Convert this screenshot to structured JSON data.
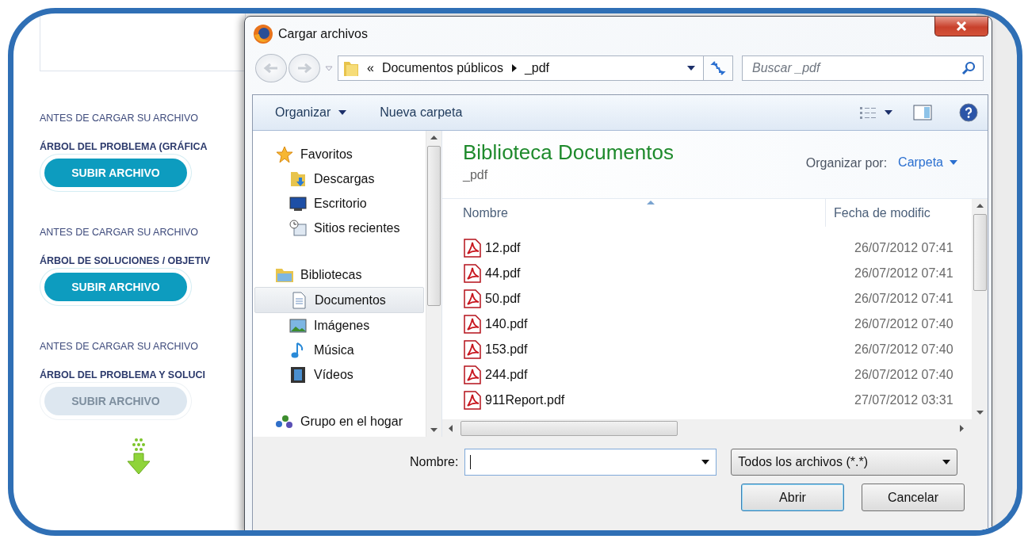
{
  "page": {
    "sections": [
      {
        "note": "ANTES DE CARGAR SU ARCHIVO",
        "title": "ÁRBOL DEL PROBLEMA (GRÁFICA",
        "button": {
          "label": "SUBIR ARCHIVO",
          "disabled": false
        }
      },
      {
        "note": "ANTES DE CARGAR SU ARCHIVO",
        "title": "ÁRBOL DE SOLUCIONES / OBJETIV",
        "button": {
          "label": "SUBIR ARCHIVO",
          "disabled": false
        }
      },
      {
        "note": "ANTES DE CARGAR SU ARCHIVO",
        "title": "ÁRBOL DEL PROBLEMA Y SOLUCI",
        "button": {
          "label": "SUBIR ARCHIVO",
          "disabled": true
        }
      }
    ]
  },
  "dialog": {
    "title": "Cargar archivos",
    "breadcrumb": {
      "prefix": "«",
      "path": [
        "Documentos públicos",
        "_pdf"
      ]
    },
    "search": {
      "placeholder": "Buscar _pdf"
    },
    "toolbar": [
      {
        "label": "Organizar",
        "kind": "menu"
      },
      {
        "label": "Nueva carpeta",
        "kind": "button"
      }
    ],
    "nav": [
      {
        "label": "Favoritos",
        "kind": "star",
        "selected": false,
        "children": [
          {
            "label": "Descargas",
            "kind": "download",
            "selected": false
          },
          {
            "label": "Escritorio",
            "kind": "desktop",
            "selected": false
          },
          {
            "label": "Sitios recientes",
            "kind": "recent",
            "selected": false
          }
        ]
      },
      {
        "label": "Bibliotecas",
        "kind": "library",
        "selected": false,
        "children": [
          {
            "label": "Documentos",
            "kind": "document",
            "selected": true
          },
          {
            "label": "Imágenes",
            "kind": "image",
            "selected": false
          },
          {
            "label": "Música",
            "kind": "music",
            "selected": false
          },
          {
            "label": "Vídeos",
            "kind": "video",
            "selected": false
          }
        ]
      },
      {
        "label": "Grupo en el hogar",
        "kind": "homegroup",
        "selected": false
      }
    ],
    "library": {
      "title": "Biblioteca Documentos",
      "subtitle": "_pdf",
      "arrange_label": "Organizar por:",
      "arrange_value": "Carpeta"
    },
    "columns": [
      "Nombre",
      "Fecha de modific"
    ],
    "files": [
      {
        "name": "12.pdf",
        "date": "26/07/2012 07:41"
      },
      {
        "name": "44.pdf",
        "date": "26/07/2012 07:41"
      },
      {
        "name": "50.pdf",
        "date": "26/07/2012 07:41"
      },
      {
        "name": "140.pdf",
        "date": "26/07/2012 07:40"
      },
      {
        "name": "153.pdf",
        "date": "26/07/2012 07:40"
      },
      {
        "name": "244.pdf",
        "date": "26/07/2012 07:40"
      },
      {
        "name": "911Report.pdf",
        "date": "27/07/2012 03:31"
      }
    ],
    "filename": {
      "label": "Nombre:"
    },
    "filetype": "Todos los archivos (*.*)",
    "buttons": [
      {
        "label": "Abrir",
        "default": true
      },
      {
        "label": "Cancelar",
        "default": false
      }
    ]
  }
}
